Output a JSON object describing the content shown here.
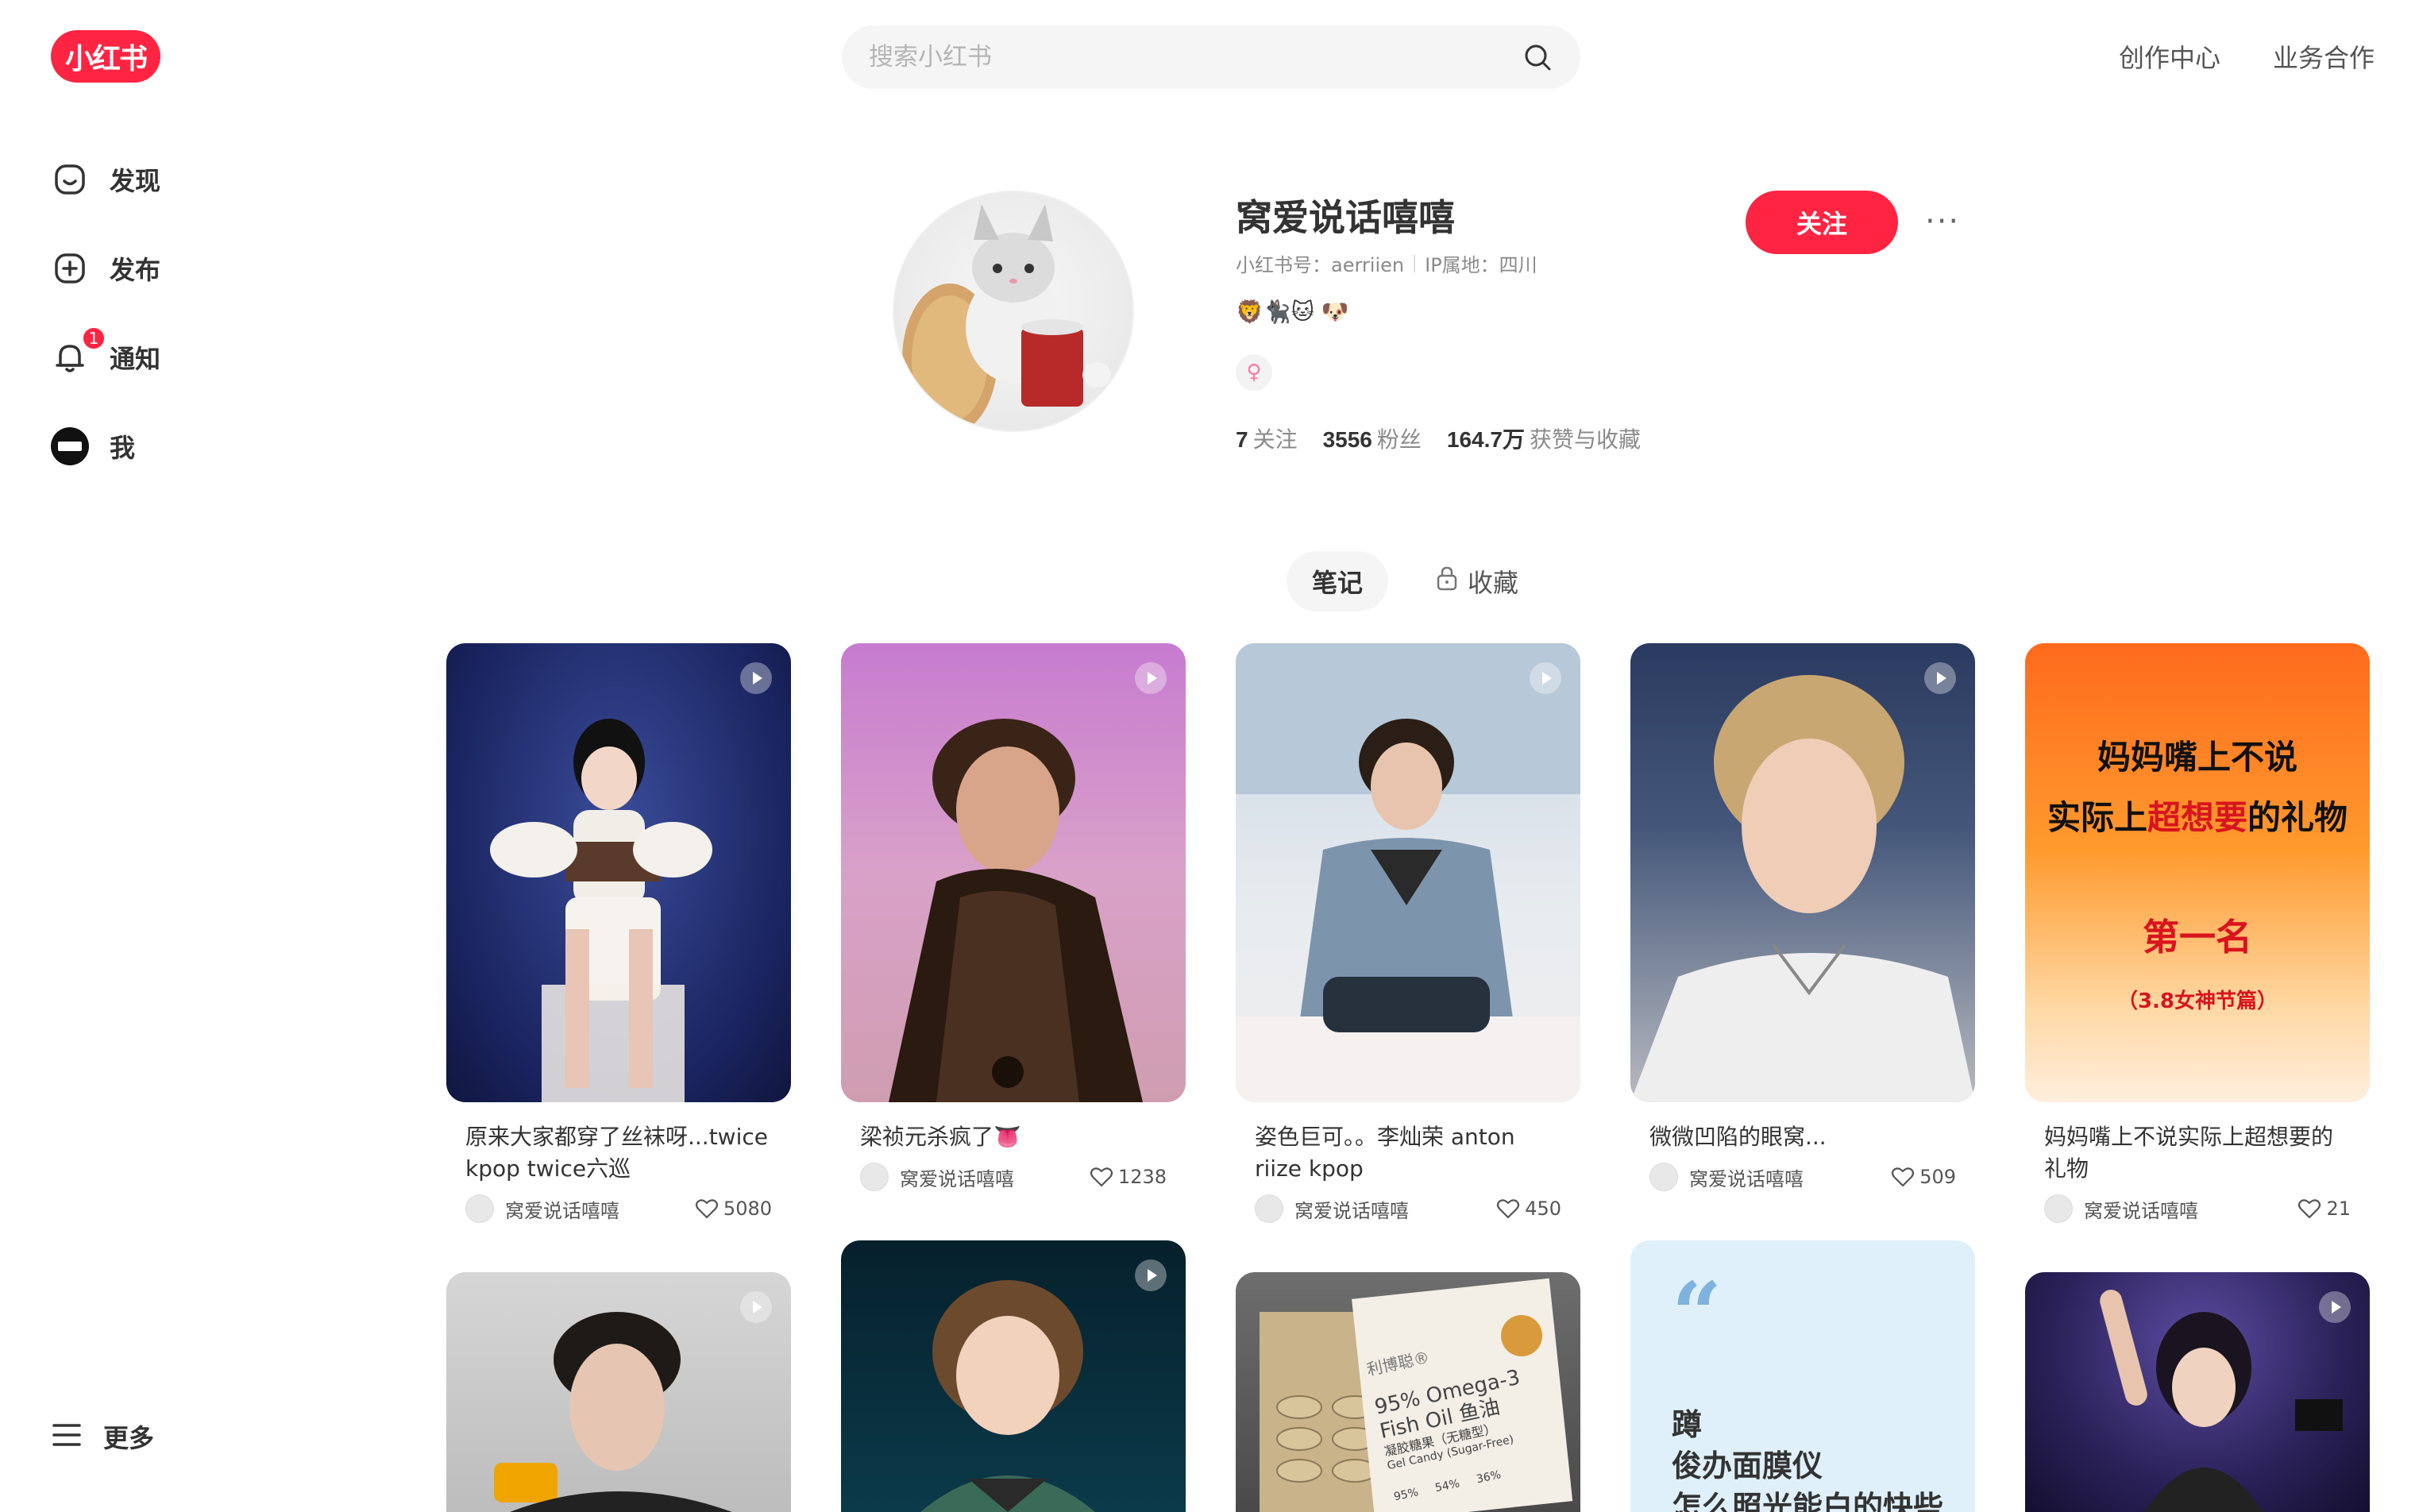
{
  "brand": {
    "logo_text": "小红书",
    "accent": "#ff2442"
  },
  "header": {
    "search_placeholder": "搜索小红书",
    "links": [
      "创作中心",
      "业务合作"
    ]
  },
  "sidebar": {
    "items": [
      {
        "label": "发现",
        "icon": "home-icon"
      },
      {
        "label": "发布",
        "icon": "plus-square-icon"
      },
      {
        "label": "通知",
        "icon": "bell-icon",
        "badge": "1"
      },
      {
        "label": "我",
        "icon": "user-avatar"
      }
    ],
    "more_label": "更多"
  },
  "profile": {
    "nickname": "窝爱说话嘻嘻",
    "red_id": "小红书号：aerriien",
    "ip": "IP属地：四川",
    "bio": "🦁🐈‍⬛🐱 🐶",
    "gender_symbol": "♀",
    "stats": [
      {
        "value": "7",
        "label": "关注"
      },
      {
        "value": "3556",
        "label": "粉丝"
      },
      {
        "value": "164.7万",
        "label": "获赞与收藏"
      }
    ],
    "follow_label": "关注",
    "more_label": "···"
  },
  "tabs": [
    {
      "label": "笔记",
      "active": true
    },
    {
      "label": "收藏",
      "active": false,
      "locked": true
    }
  ],
  "promo_cover": {
    "line1": "妈妈嘴上不说",
    "line2a": "实际上",
    "line2b": "超想要",
    "line2c": "的礼物",
    "line3": "第一名",
    "line4": "（3.8女神节篇）"
  },
  "omega_cover": {
    "brand": "利博聪®",
    "line1": "95% Omega-3",
    "line2": "Fish Oil 鱼油",
    "line3": "凝胶糖果（无糖型）",
    "line4": "Gel Candy (Sugar-Free)",
    "pct1": "95%",
    "pct2": "54%",
    "pct3": "36%"
  },
  "quote_cover": {
    "quote_mark": "“",
    "line1": "蹲",
    "line2": "俊办面膜仪",
    "line3": "怎么照光能白的快些"
  },
  "notes": [
    {
      "title": "原来大家都穿了丝袜呀...twice kpop twice六巡",
      "author": "窝爱说话嘻嘻",
      "likes": "5080",
      "video": true
    },
    {
      "title": "梁祯元杀疯了👅",
      "author": "窝爱说话嘻嘻",
      "likes": "1238",
      "video": true
    },
    {
      "title": "姿色巨可。。李灿荣 anton riize kpop",
      "author": "窝爱说话嘻嘻",
      "likes": "450",
      "video": true
    },
    {
      "title": "微微凹陷的眼窝...",
      "author": "窝爱说话嘻嘻",
      "likes": "509",
      "video": true
    },
    {
      "title": "妈妈嘴上不说实际上超想要的礼物",
      "author": "窝爱说话嘻嘻",
      "likes": "21",
      "video": false
    }
  ]
}
